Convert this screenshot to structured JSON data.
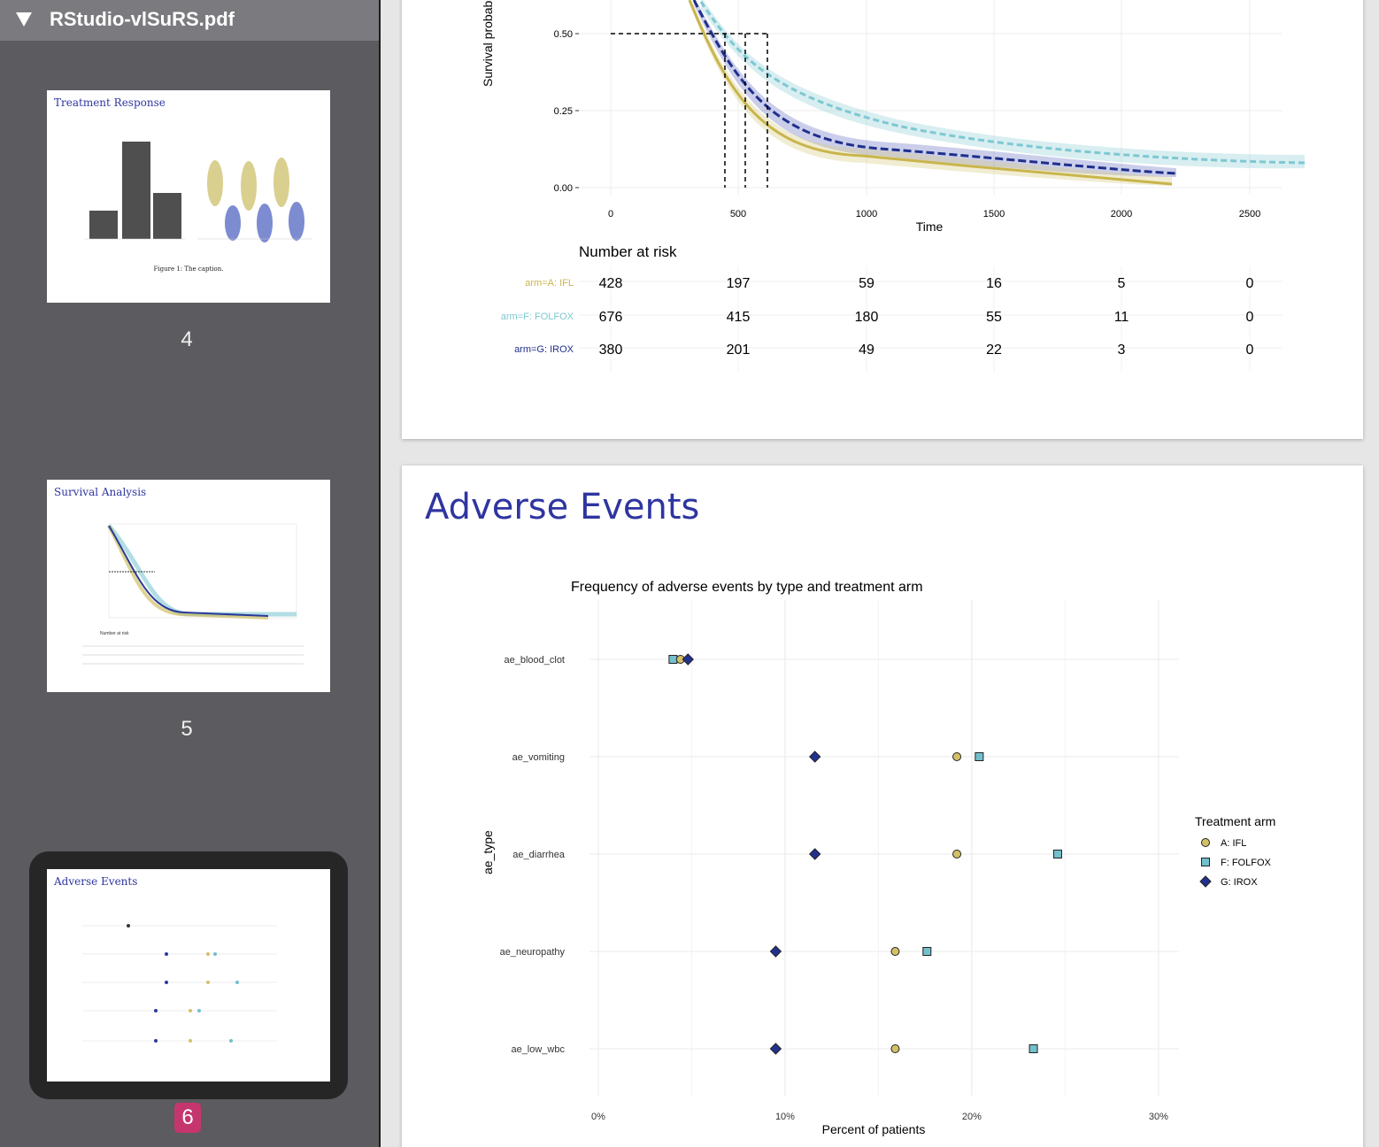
{
  "sidebar": {
    "doc_title": "RStudio-vlSuRS.pdf",
    "thumbs": [
      {
        "title": "Treatment Response",
        "page": "4",
        "caption": "Figure 1: The caption."
      },
      {
        "title": "Survival Analysis",
        "page": "5"
      },
      {
        "title": "Adverse Events",
        "page": "6"
      }
    ]
  },
  "survival": {
    "ylabel": "Survival probab",
    "xlabel": "Time",
    "y_ticks": [
      "0.50",
      "0.25",
      "0.00"
    ],
    "x_ticks": [
      "0",
      "500",
      "1000",
      "1500",
      "2000",
      "2500"
    ],
    "risk_title": "Number at risk",
    "risk_rows": [
      {
        "label": "arm=A: IFL",
        "color": "#c9b54c",
        "values": [
          "428",
          "197",
          "59",
          "16",
          "5",
          "0"
        ]
      },
      {
        "label": "arm=F: FOLFOX",
        "color": "#7ec8d2",
        "values": [
          "676",
          "415",
          "180",
          "55",
          "11",
          "0"
        ]
      },
      {
        "label": "arm=G: IROX",
        "color": "#1f2f8c",
        "values": [
          "380",
          "201",
          "49",
          "22",
          "3",
          "0"
        ]
      }
    ]
  },
  "adverse": {
    "slide_title": "Adverse Events",
    "chart_title": "Frequency of adverse events by type and treatment arm",
    "xlabel": "Percent of patients",
    "ylabel": "ae_type",
    "legend_title": "Treatment arm",
    "legend": [
      "A: IFL",
      "F: FOLFOX",
      "G: IROX"
    ]
  },
  "chart_data": {
    "type": "scatter",
    "title": "Frequency of adverse events by type and treatment arm",
    "xlabel": "Percent of patients",
    "ylabel": "ae_type",
    "x_ticks": [
      "0%",
      "10%",
      "20%",
      "30%"
    ],
    "xlim": [
      0,
      31
    ],
    "categories": [
      "ae_blood_clot",
      "ae_vomiting",
      "ae_diarrhea",
      "ae_neuropathy",
      "ae_low_wbc"
    ],
    "series": [
      {
        "name": "A: IFL",
        "color": "#d4c067",
        "marker": "circle",
        "values": [
          4.4,
          19.2,
          19.2,
          15.9,
          15.9
        ]
      },
      {
        "name": "F: FOLFOX",
        "color": "#73bfcc",
        "marker": "square",
        "values": [
          4.0,
          20.4,
          24.6,
          17.6,
          23.3
        ]
      },
      {
        "name": "G: IROX",
        "color": "#22318f",
        "marker": "diamond",
        "values": [
          4.8,
          11.6,
          11.6,
          9.5,
          9.5
        ]
      }
    ],
    "legend_position": "right",
    "grid": true
  }
}
